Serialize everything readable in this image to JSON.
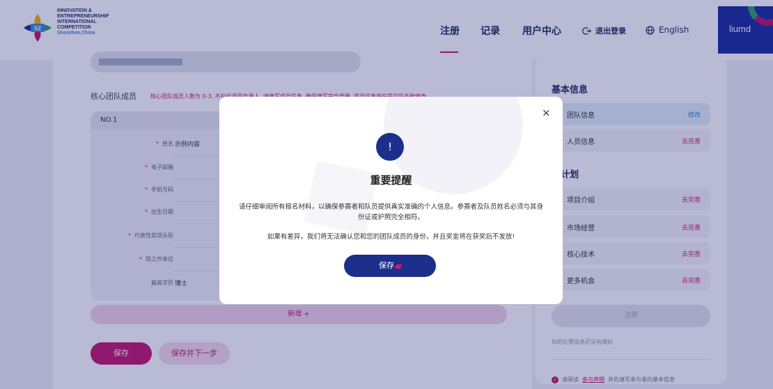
{
  "header": {
    "logo_lines": [
      "INNOVATION &",
      "ENTREPRENEURSHIP",
      "INTERNATIONAL",
      "COMPETITION"
    ],
    "logo_city": "Shenzhen.China",
    "logo_badge": "SZ",
    "nav": [
      "注册",
      "记录",
      "用户中心"
    ],
    "logout": "退出登录",
    "language": "English",
    "username": "liumd"
  },
  "form": {
    "section_title": "核心团队成员",
    "section_note": "核心团队成员人数为 0-3, 不包括项目负责人, 请填写成员信息, 确保填写完全准确, 成员信息将在提交后不能修改",
    "member_header": "NO.1",
    "fields": [
      {
        "label": "姓名",
        "value": "示例内容",
        "required": true
      },
      {
        "label": "电子邮箱",
        "value": "",
        "required": true
      },
      {
        "label": "手机号码",
        "value": "",
        "required": true
      },
      {
        "label": "出生日期",
        "value": "",
        "required": true
      },
      {
        "label": "代表性奖项头衔",
        "value": "",
        "required": true
      },
      {
        "label": "现工作单位",
        "value": "",
        "required": true
      },
      {
        "label": "最高学历",
        "value": "博士",
        "required": false
      }
    ],
    "add_button": "新增 +",
    "save_button": "保存",
    "save_next_button": "保存并下一步"
  },
  "sidebar": {
    "basic_title": "基本信息",
    "basic_items": [
      {
        "label": "团队信息",
        "status": "修改"
      },
      {
        "label": "人员信息",
        "status": "去完善"
      }
    ],
    "plan_title": "业计划",
    "plan_items": [
      {
        "label": "项目介绍",
        "status": "去完善"
      },
      {
        "label": "市场经营",
        "status": "去完善"
      },
      {
        "label": "核心技术",
        "status": "去完善"
      },
      {
        "label": "更多机会",
        "status": "去完善"
      }
    ],
    "register_button": "注册",
    "hint": "你的比赛信息还没有填好",
    "agree_prefix": "请阅读",
    "agree_link": "参与声明",
    "agree_suffix": "并先填写参与者的基本信息"
  },
  "modal": {
    "close_glyph": "×",
    "icon_glyph": "!",
    "title": "重要提醒",
    "line1": "请仔细审阅所有报名材料，以确保参赛者和队员提供真实准确的个人信息。参赛者及队员姓名必须与其身份证或护照完全相符。",
    "line2": "如果有差异，我们将无法确认您和您的团队成员的身份，并且奖金将在获奖后不发放!",
    "save_button": "保存"
  },
  "colors": {
    "brand_navy": "#1d2f8c",
    "brand_magenta": "#c4186f",
    "overlay": "#171c6e",
    "user_box": "#1a2f9e"
  }
}
